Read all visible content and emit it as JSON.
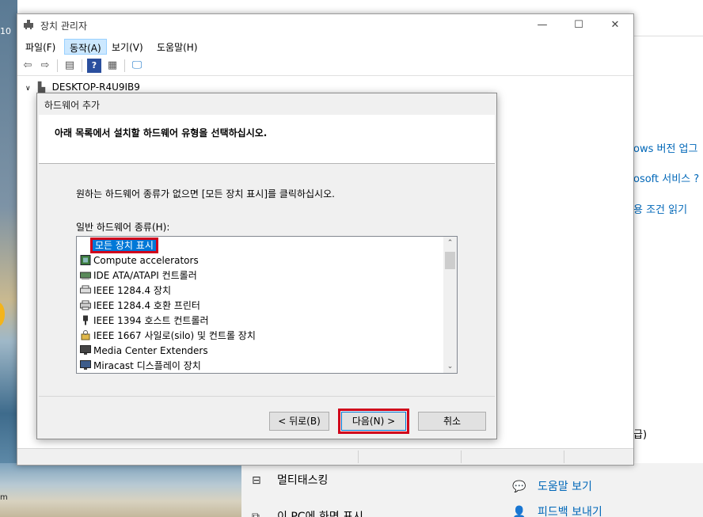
{
  "window": {
    "title": "장치 관리자",
    "controls": {
      "minimize": "—",
      "maximize": "☐",
      "close": "✕"
    }
  },
  "menu": [
    {
      "label": "파일(F)",
      "active": false
    },
    {
      "label": "동작(A)",
      "active": true
    },
    {
      "label": "보기(V)",
      "active": false
    },
    {
      "label": "도움말(H)",
      "active": false
    }
  ],
  "tree": {
    "root": "DESKTOP-R4U9IB9"
  },
  "dialog": {
    "title": "하드웨어 추가",
    "heading": "아래 목록에서 설치할 하드웨어 유형을 선택하십시오.",
    "instruction": "원하는 하드웨어 종류가 없으면 [모든 장치 표시]를 클릭하십시오.",
    "list_label": "일반 하드웨어 종류(H):",
    "items": [
      {
        "label": "모든 장치 표시",
        "icon": "none",
        "selected": true
      },
      {
        "label": "Compute accelerators",
        "icon": "chip-icon",
        "selected": false
      },
      {
        "label": "IDE ATA/ATAPI 컨트롤러",
        "icon": "ide-controller-icon",
        "selected": false
      },
      {
        "label": "IEEE 1284.4 장치",
        "icon": "printer-port-icon",
        "selected": false
      },
      {
        "label": "IEEE 1284.4 호환 프린터",
        "icon": "printer-icon",
        "selected": false
      },
      {
        "label": "IEEE 1394 호스트 컨트롤러",
        "icon": "firewire-icon",
        "selected": false
      },
      {
        "label": "IEEE 1667 사일로(silo) 및 컨트롤 장치",
        "icon": "usb-key-icon",
        "selected": false
      },
      {
        "label": "Media Center Extenders",
        "icon": "monitor-icon",
        "selected": false
      },
      {
        "label": "Miracast 디스플레이 장치",
        "icon": "display-icon",
        "selected": false
      }
    ],
    "buttons": {
      "back": "< 뒤로(B)",
      "next": "다음(N) >",
      "cancel": "취소"
    }
  },
  "background": {
    "desktop_number": "10",
    "desktop_letter": "m",
    "links": [
      "ows 버전 업그",
      "osoft 서비스 ?",
      "용 조건 읽기"
    ],
    "partial_text": "급)",
    "items": [
      "멀티태스킹",
      "이 PC에 화면 표시"
    ],
    "help": [
      "도움말 보기",
      "피드백 보내기"
    ]
  }
}
